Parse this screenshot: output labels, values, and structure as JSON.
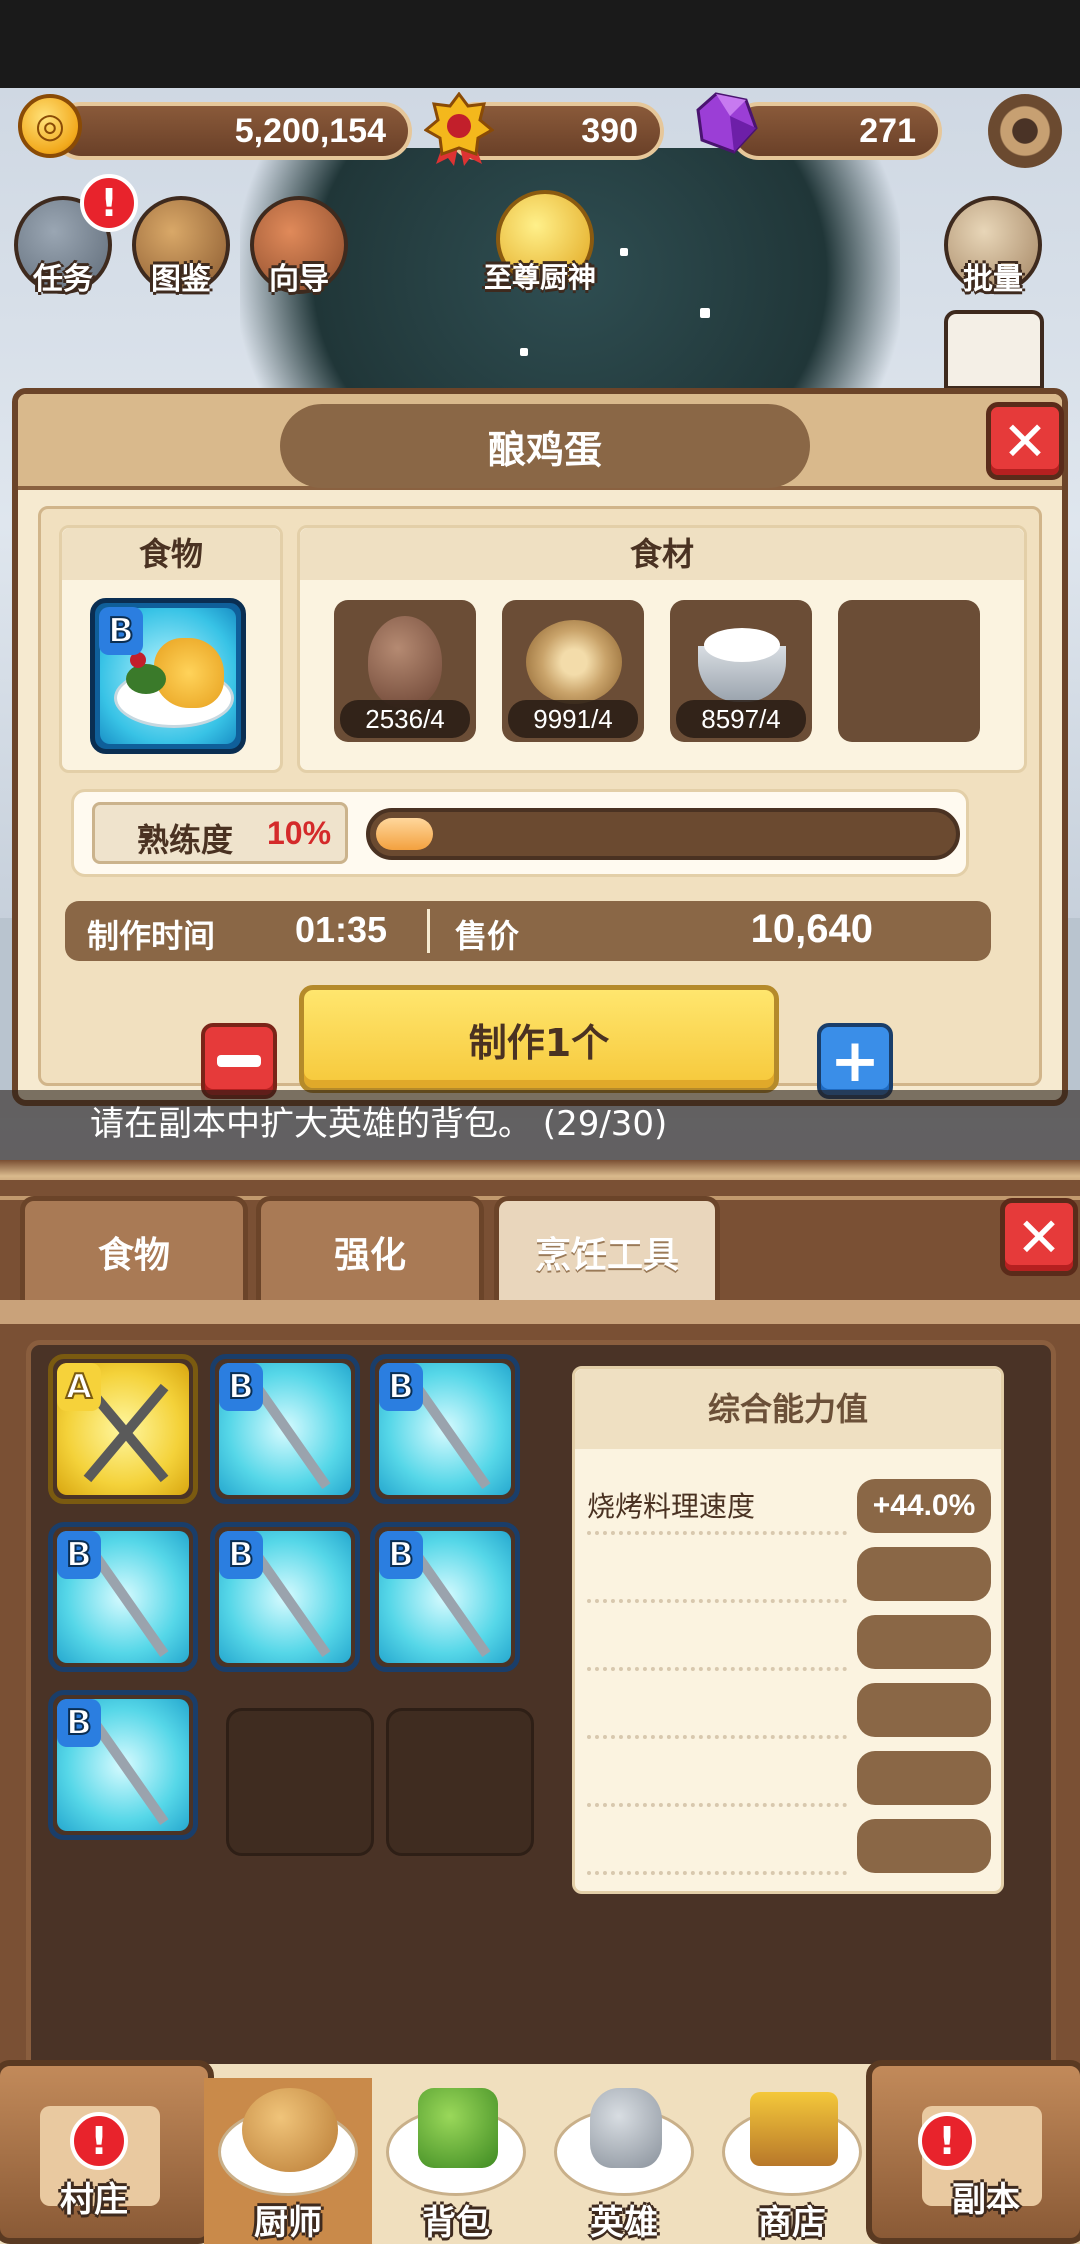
{
  "currency": {
    "gold": "5,200,154",
    "medal": "390",
    "gems": "271",
    "gold_icon": "coin-icon",
    "medal_icon": "medal-icon",
    "gem_icon": "purple-gem-icon"
  },
  "top_buttons": [
    {
      "label": "任务",
      "icon": "quest-icon"
    },
    {
      "label": "图鉴",
      "icon": "book-icon"
    },
    {
      "label": "向导",
      "icon": "signpost-icon"
    },
    {
      "label": "至尊厨神",
      "icon": "crown-icon"
    },
    {
      "label": "批量",
      "icon": "bird-icon"
    }
  ],
  "dialog": {
    "title": "酿鸡蛋",
    "food_header": "食物",
    "ingredient_header": "食材",
    "food_grade": "B",
    "ingredients": [
      {
        "count": "2536/4",
        "icon": "egg-icon"
      },
      {
        "count": "9991/4",
        "icon": "shell-icon"
      },
      {
        "count": "8597/4",
        "icon": "salt-bowl-icon"
      }
    ],
    "proficiency_label": "熟练度",
    "proficiency_value": "10%",
    "proficiency_fraction": 0.1,
    "time_label": "制作时间",
    "time_value": "01:35",
    "price_label": "售价",
    "price_value": "10,640",
    "make_button": "制作1个"
  },
  "notice_text": "请在副本中扩大英雄的背包。 (29/30)",
  "tabs": [
    "食物",
    "强化",
    "烹饪工具"
  ],
  "tools": [
    {
      "grade": "A"
    },
    {
      "grade": "B"
    },
    {
      "grade": "B"
    },
    {
      "grade": "B"
    },
    {
      "grade": "B"
    },
    {
      "grade": "B"
    },
    {
      "grade": "B"
    }
  ],
  "stats": {
    "title": "综合能力值",
    "rows": [
      {
        "name": "烧烤料理速度",
        "value": "+44.0%"
      }
    ]
  },
  "nav": {
    "village": "村庄",
    "chef": "厨师",
    "bag": "背包",
    "hero": "英雄",
    "shop": "商店",
    "dungeon": "副本"
  },
  "alert_mark": "!"
}
